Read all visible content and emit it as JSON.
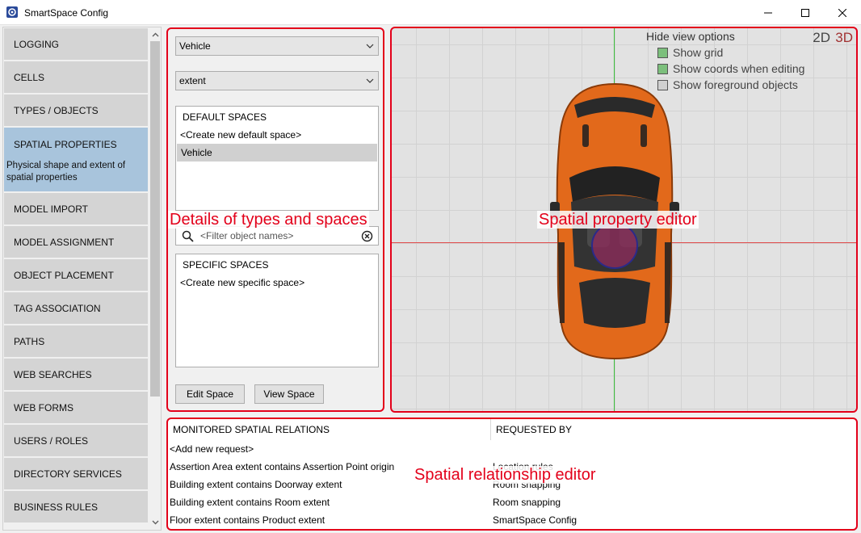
{
  "window": {
    "title": "SmartSpace Config",
    "controls": [
      "minimize-icon",
      "maximize-icon",
      "close-icon"
    ]
  },
  "nav": {
    "items": [
      {
        "label": "LOGGING"
      },
      {
        "label": "CELLS"
      },
      {
        "label": "TYPES / OBJECTS"
      },
      {
        "label": "SPATIAL PROPERTIES",
        "description": "Physical shape and extent of spatial properties",
        "active": true
      },
      {
        "label": "MODEL IMPORT"
      },
      {
        "label": "MODEL ASSIGNMENT"
      },
      {
        "label": "OBJECT PLACEMENT"
      },
      {
        "label": "TAG ASSOCIATION"
      },
      {
        "label": "PATHS"
      },
      {
        "label": "WEB SEARCHES"
      },
      {
        "label": "WEB FORMS"
      },
      {
        "label": "USERS / ROLES"
      },
      {
        "label": "DIRECTORY SERVICES"
      },
      {
        "label": "BUSINESS RULES"
      }
    ]
  },
  "details": {
    "type_select": "Vehicle",
    "property_select": "extent",
    "default_spaces": {
      "header": "DEFAULT SPACES",
      "rows": [
        "<Create new default space>",
        "Vehicle"
      ],
      "selected": "Vehicle"
    },
    "filter_placeholder": "<Filter object names>",
    "specific_spaces": {
      "header": "SPECIFIC SPACES",
      "rows": [
        "<Create new specific space>"
      ]
    },
    "edit_button": "Edit Space",
    "view_button": "View Space",
    "overlay_label": "Details of types and spaces"
  },
  "editor": {
    "overlay_label": "Spatial property editor",
    "hide_view_options": "Hide view options",
    "options": [
      {
        "label": "Show grid",
        "checked": true
      },
      {
        "label": "Show coords when editing",
        "checked": true
      },
      {
        "label": "Show foreground objects",
        "checked": false
      }
    ],
    "mode_2d": "2D",
    "mode_3d": "3D",
    "colors": {
      "grid_x_axis": "#e0494a",
      "grid_y_axis": "#3cbf3c",
      "car_body": "#e2691b",
      "extent_circle": "#8b2c5a"
    }
  },
  "relations": {
    "overlay_label": "Spatial relationship editor",
    "col1_header": "MONITORED SPATIAL RELATIONS",
    "col2_header": "REQUESTED BY",
    "rows": [
      {
        "relation": "<Add new request>",
        "requested_by": ""
      },
      {
        "relation": "Assertion Area extent contains Assertion Point origin",
        "requested_by": "Location rules"
      },
      {
        "relation": "Building extent contains Doorway extent",
        "requested_by": "Room snapping"
      },
      {
        "relation": "Building extent contains Room extent",
        "requested_by": "Room snapping"
      },
      {
        "relation": "Floor extent contains Product extent",
        "requested_by": "SmartSpace Config"
      }
    ]
  }
}
